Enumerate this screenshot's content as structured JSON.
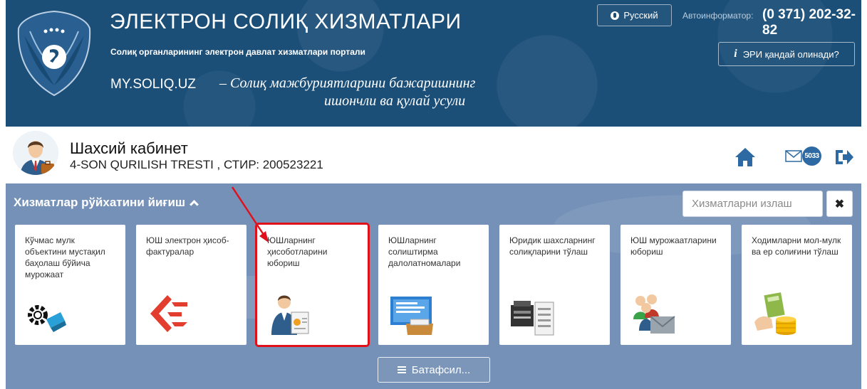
{
  "header": {
    "title": "ЭЛЕКТРОН СОЛИҚ ХИЗМАТЛАРИ",
    "subtitle": "Солиқ органларининг электрон давлат хизматлари портали",
    "domain": "MY.SOLIQ.UZ",
    "slogan_line1": "– Солиқ мажбуриятларини бажаришнинг",
    "slogan_line2": "ишончли ва қулай усули",
    "language_button": "Русский",
    "autoinformer_label": "Автоинформатор:",
    "autoinformer_phone": "(0 371) 202-32-82",
    "eri_button": "ЭРИ қандай олинади?"
  },
  "profile": {
    "title": "Шахсий кабинет",
    "organization": "4-SON QURILISH TRESTI , СТИР: 200523221",
    "mail_count": "5033"
  },
  "services": {
    "title": "Хизматлар рўйхатини йиғиш",
    "search_placeholder": "Хизматларни излаш",
    "clear_label": "✖",
    "more_button": "Батафсил...",
    "cards": [
      {
        "label": "Кўчмас мулк объектини мустақил баҳолаш бўйича мурожаат",
        "icon": "gear-key-icon"
      },
      {
        "label": "ЮШ электрон ҳисоб-фактуралар",
        "icon": "e-invoice-logo-icon"
      },
      {
        "label": "ЮШларнинг ҳисоботларини юбориш",
        "icon": "businessman-report-icon",
        "selected": true
      },
      {
        "label": "ЮШларнинг солиштирма далолатномалари",
        "icon": "monitor-archive-icon"
      },
      {
        "label": "Юридик шахсларнинг солиқларини тўлаш",
        "icon": "printer-document-icon"
      },
      {
        "label": "ЮШ мурожаатларини юбориш",
        "icon": "people-envelope-icon"
      },
      {
        "label": "Ходимларни мол-мулк ва ер солиғини тўлаш",
        "icon": "calculator-coins-icon"
      }
    ]
  },
  "colors": {
    "header_bg": "#1c4f78",
    "panel_bg": "#7591b7",
    "highlight": "#e0111b",
    "icon_blue": "#2d6aa3"
  }
}
